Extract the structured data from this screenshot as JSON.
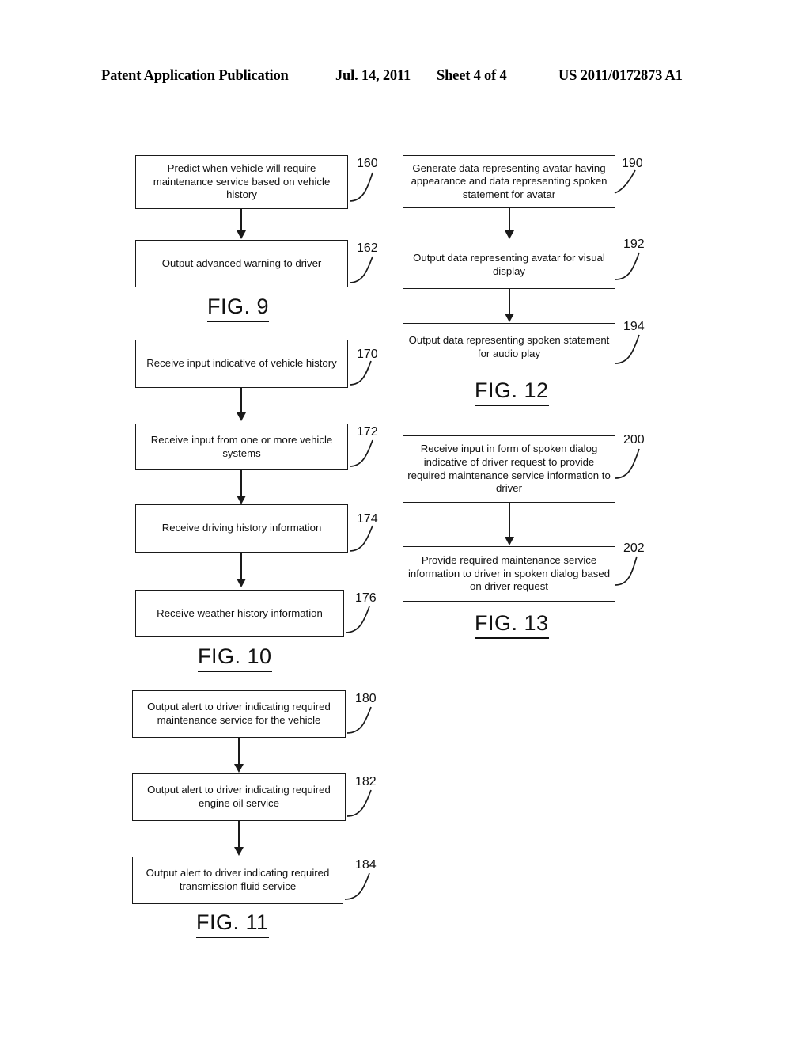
{
  "header": {
    "left": "Patent Application Publication",
    "date": "Jul. 14, 2011",
    "sheet": "Sheet 4 of 4",
    "number": "US 2011/0172873 A1"
  },
  "figures": [
    {
      "caption": "FIG. 9",
      "steps": [
        {
          "ref": "160",
          "text": "Predict when vehicle will require maintenance service based on vehicle history"
        },
        {
          "ref": "162",
          "text": "Output advanced warning to driver"
        }
      ]
    },
    {
      "caption": "FIG. 10",
      "steps": [
        {
          "ref": "170",
          "text": "Receive input indicative of vehicle history"
        },
        {
          "ref": "172",
          "text": "Receive input from one or more vehicle systems"
        },
        {
          "ref": "174",
          "text": "Receive driving history information"
        },
        {
          "ref": "176",
          "text": "Receive weather history information"
        }
      ]
    },
    {
      "caption": "FIG. 11",
      "steps": [
        {
          "ref": "180",
          "text": "Output alert to driver indicating required maintenance service for the vehicle"
        },
        {
          "ref": "182",
          "text": "Output alert to driver indicating required engine oil service"
        },
        {
          "ref": "184",
          "text": "Output alert to driver indicating required transmission fluid service"
        }
      ]
    },
    {
      "caption": "FIG. 12",
      "steps": [
        {
          "ref": "190",
          "text": "Generate data representing avatar having appearance and data representing spoken statement for avatar"
        },
        {
          "ref": "192",
          "text": "Output data representing avatar for visual display"
        },
        {
          "ref": "194",
          "text": "Output data representing spoken statement for audio play"
        }
      ]
    },
    {
      "caption": "FIG. 13",
      "steps": [
        {
          "ref": "200",
          "text": "Receive input in form of spoken dialog indicative of driver request to provide required maintenance service information to driver"
        },
        {
          "ref": "202",
          "text": "Provide required maintenance service information to driver in spoken dialog based on driver request"
        }
      ]
    }
  ]
}
